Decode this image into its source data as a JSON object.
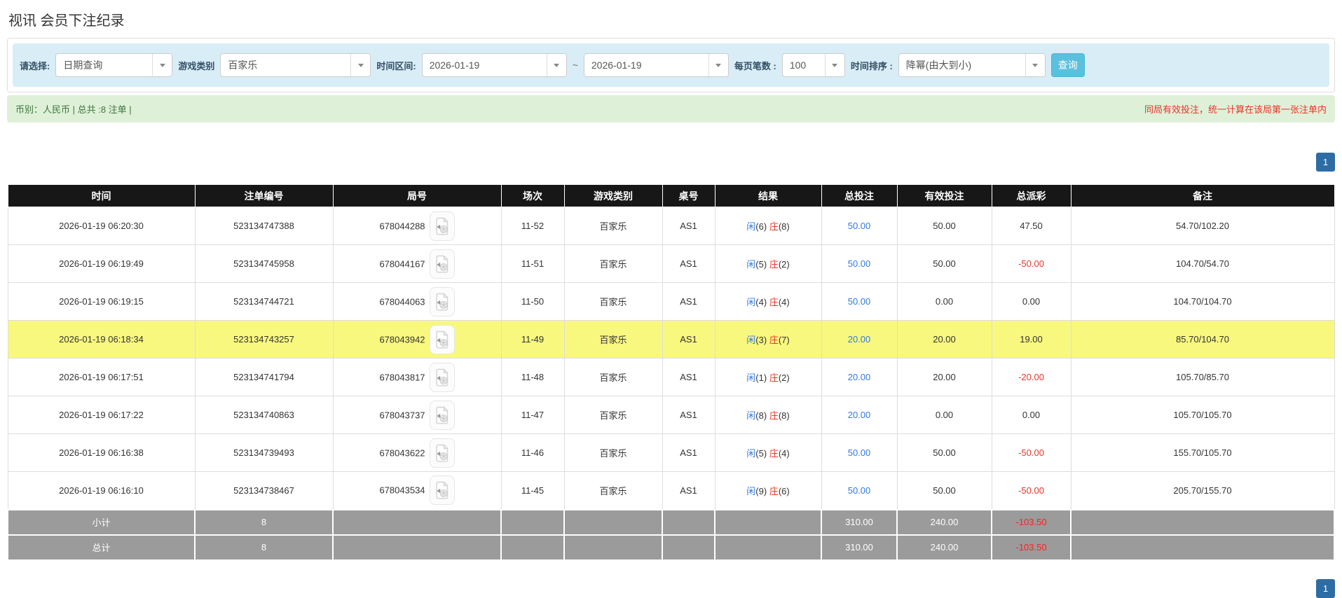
{
  "page_title": "视讯 会员下注纪录",
  "filter_bar": {
    "query_type": {
      "label": "请选择:",
      "value": "日期查询"
    },
    "game_category": {
      "label": "游戏类别",
      "value": "百家乐"
    },
    "time_range": {
      "label": "时间区间:",
      "from": "2026-01-19",
      "separator": "~",
      "to": "2026-01-19"
    },
    "page_size": {
      "label": "每页笔数 :",
      "value": "100"
    },
    "time_sort": {
      "label": "时间排序 :",
      "value": "降幂(由大到小)"
    },
    "search_button": "查询"
  },
  "status_bar": {
    "summary": "币别：人民币 | 总共 :8 注单 |",
    "notice": "同局有效投注，统一计算在该局第一张注单内"
  },
  "pagination": {
    "current_page": "1"
  },
  "table": {
    "columns": [
      "时间",
      "注单编号",
      "局号",
      "场次",
      "游戏类别",
      "桌号",
      "结果",
      "总投注",
      "有效投注",
      "总派彩",
      "备注"
    ],
    "rows": [
      {
        "time": "2026-01-19 06:20:30",
        "bet_id": "523134747388",
        "round_id": "678044288",
        "session": "11-52",
        "game": "百家乐",
        "table_id": "AS1",
        "result_player": "闲",
        "result_player_n": "(6)",
        "result_banker": "庄",
        "result_banker_n": "(8)",
        "total_bet": "50.00",
        "valid_bet": "50.00",
        "payout": "47.50",
        "note": "54.70/102.20"
      },
      {
        "time": "2026-01-19 06:19:49",
        "bet_id": "523134745958",
        "round_id": "678044167",
        "session": "11-51",
        "game": "百家乐",
        "table_id": "AS1",
        "result_player": "闲",
        "result_player_n": "(5)",
        "result_banker": "庄",
        "result_banker_n": "(2)",
        "total_bet": "50.00",
        "valid_bet": "50.00",
        "payout": "-50.00",
        "note": "104.70/54.70"
      },
      {
        "time": "2026-01-19 06:19:15",
        "bet_id": "523134744721",
        "round_id": "678044063",
        "session": "11-50",
        "game": "百家乐",
        "table_id": "AS1",
        "result_player": "闲",
        "result_player_n": "(4)",
        "result_banker": "庄",
        "result_banker_n": "(4)",
        "total_bet": "50.00",
        "valid_bet": "0.00",
        "payout": "0.00",
        "note": "104.70/104.70"
      },
      {
        "time": "2026-01-19 06:18:34",
        "bet_id": "523134743257",
        "round_id": "678043942",
        "session": "11-49",
        "game": "百家乐",
        "table_id": "AS1",
        "result_player": "闲",
        "result_player_n": "(3)",
        "result_banker": "庄",
        "result_banker_n": "(7)",
        "total_bet": "20.00",
        "valid_bet": "20.00",
        "payout": "19.00",
        "note": "85.70/104.70"
      },
      {
        "time": "2026-01-19 06:17:51",
        "bet_id": "523134741794",
        "round_id": "678043817",
        "session": "11-48",
        "game": "百家乐",
        "table_id": "AS1",
        "result_player": "闲",
        "result_player_n": "(1)",
        "result_banker": "庄",
        "result_banker_n": "(2)",
        "total_bet": "20.00",
        "valid_bet": "20.00",
        "payout": "-20.00",
        "note": "105.70/85.70"
      },
      {
        "time": "2026-01-19 06:17:22",
        "bet_id": "523134740863",
        "round_id": "678043737",
        "session": "11-47",
        "game": "百家乐",
        "table_id": "AS1",
        "result_player": "闲",
        "result_player_n": "(8)",
        "result_banker": "庄",
        "result_banker_n": "(8)",
        "total_bet": "20.00",
        "valid_bet": "0.00",
        "payout": "0.00",
        "note": "105.70/105.70"
      },
      {
        "time": "2026-01-19 06:16:38",
        "bet_id": "523134739493",
        "round_id": "678043622",
        "session": "11-46",
        "game": "百家乐",
        "table_id": "AS1",
        "result_player": "闲",
        "result_player_n": "(5)",
        "result_banker": "庄",
        "result_banker_n": "(4)",
        "total_bet": "50.00",
        "valid_bet": "50.00",
        "payout": "-50.00",
        "note": "155.70/105.70"
      },
      {
        "time": "2026-01-19 06:16:10",
        "bet_id": "523134738467",
        "round_id": "678043534",
        "session": "11-45",
        "game": "百家乐",
        "table_id": "AS1",
        "result_player": "闲",
        "result_player_n": "(9)",
        "result_banker": "庄",
        "result_banker_n": "(6)",
        "total_bet": "50.00",
        "valid_bet": "50.00",
        "payout": "-50.00",
        "note": "205.70/155.70"
      }
    ],
    "subtotal": {
      "label": "小计",
      "count": "8",
      "total_bet": "310.00",
      "valid_bet": "240.00",
      "payout": "-103.50"
    },
    "total": {
      "label": "总计",
      "count": "8",
      "total_bet": "310.00",
      "valid_bet": "240.00",
      "payout": "-103.50"
    }
  },
  "colors": {
    "accent_blue": "#5bc0de",
    "active_page_bg": "#2e6da4",
    "highlight_row": "#f8f87e",
    "value_blue": "#3178e6",
    "value_red": "#e8342a",
    "header_bg": "#171717",
    "summary_bg": "#9b9b9b",
    "filter_bg": "#d9edf7",
    "status_bg": "#dff0d8",
    "status_text": "#3c763d"
  }
}
